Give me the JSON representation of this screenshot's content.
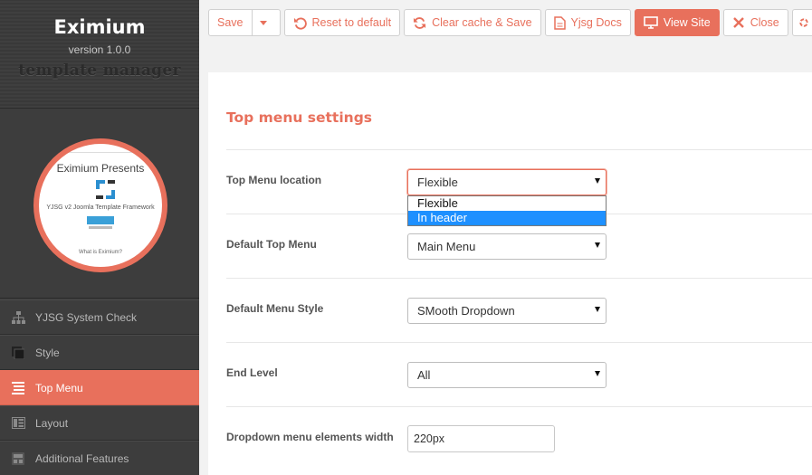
{
  "sidebar": {
    "app_name": "Eximium",
    "version": "version 1.0.0",
    "subtitle": "template manager",
    "preview": {
      "title": "Eximium Presents",
      "subtitle": "YJSG v2 Joomla Template Framework",
      "footer_text": "What is Eximium?"
    },
    "items": [
      {
        "label": "YJSG System Check",
        "icon": "sitemap-icon"
      },
      {
        "label": "Style",
        "icon": "style-icon"
      },
      {
        "label": "Top Menu",
        "icon": "menu-icon"
      },
      {
        "label": "Layout",
        "icon": "layout-icon"
      },
      {
        "label": "Additional Features",
        "icon": "features-icon"
      }
    ],
    "active_index": 2
  },
  "toolbar": {
    "save": "Save",
    "reset": "Reset to default",
    "clear_cache": "Clear cache & Save",
    "docs": "Yjsg Docs",
    "view_site": "View Site",
    "close": "Close"
  },
  "panel": {
    "title": "Top menu settings",
    "fields": {
      "top_menu_location": {
        "label": "Top Menu location",
        "value": "Flexible",
        "options": [
          "Flexible",
          "In header"
        ],
        "highlighted": "In header"
      },
      "default_top_menu": {
        "label": "Default Top Menu",
        "value": "Main Menu"
      },
      "default_menu_style": {
        "label": "Default Menu Style",
        "value": "SMooth Dropdown"
      },
      "end_level": {
        "label": "End Level",
        "value": "All"
      },
      "dropdown_width": {
        "label": "Dropdown menu elements width",
        "value": "220px"
      }
    }
  },
  "colors": {
    "accent": "#e8705c",
    "sidebar_bg": "#3d3d3d",
    "highlight": "#1e90ff"
  }
}
